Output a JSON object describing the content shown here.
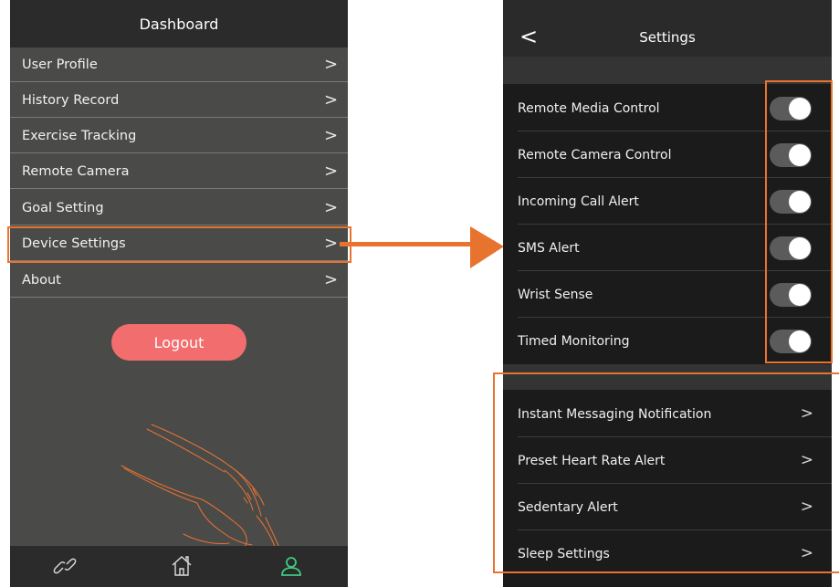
{
  "dashboard": {
    "title": "Dashboard",
    "items": [
      {
        "label": "User Profile"
      },
      {
        "label": "History Record"
      },
      {
        "label": "Exercise Tracking"
      },
      {
        "label": "Remote Camera"
      },
      {
        "label": "Goal Setting"
      },
      {
        "label": "Device Settings"
      },
      {
        "label": "About"
      }
    ],
    "chevron": ">",
    "logout_label": "Logout",
    "nav": [
      {
        "icon": "link-icon"
      },
      {
        "icon": "home-icon"
      },
      {
        "icon": "user-icon",
        "active": true
      }
    ]
  },
  "settings": {
    "title": "Settings",
    "back": "<",
    "toggles": [
      {
        "label": "Remote Media Control",
        "on": true
      },
      {
        "label": "Remote Camera Control",
        "on": true
      },
      {
        "label": "Incoming Call Alert",
        "on": true
      },
      {
        "label": "SMS Alert",
        "on": true
      },
      {
        "label": "Wrist Sense",
        "on": true
      },
      {
        "label": "Timed Monitoring",
        "on": true
      }
    ],
    "links": [
      {
        "label": "Instant Messaging Notification"
      },
      {
        "label": "Preset Heart Rate Alert"
      },
      {
        "label": "Sedentary Alert"
      },
      {
        "label": "Sleep Settings"
      }
    ],
    "chevron": ">"
  },
  "colors": {
    "highlight": "#e8732f",
    "logout": "#f26d6d",
    "active_nav": "#3ecb84"
  }
}
